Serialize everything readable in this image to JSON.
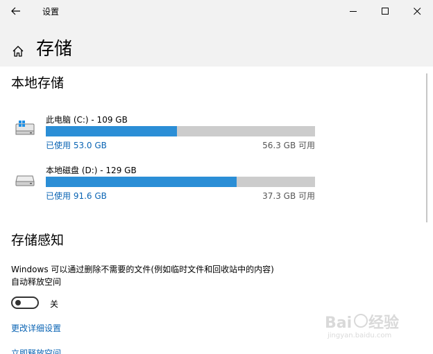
{
  "window": {
    "title": "设置"
  },
  "header": {
    "page_title": "存储"
  },
  "local_storage": {
    "section_title": "本地存储",
    "drives": [
      {
        "name": "此电脑 (C:) - 109 GB",
        "used": "已使用 53.0 GB",
        "free": "56.3 GB 可用",
        "used_fraction": 0.486,
        "icon": "windows-drive-icon"
      },
      {
        "name": "本地磁盘 (D:) - 129 GB",
        "used": "已使用 91.6 GB",
        "free": "37.3 GB 可用",
        "used_fraction": 0.71,
        "icon": "hard-drive-icon"
      }
    ]
  },
  "storage_sense": {
    "section_title": "存储感知",
    "description_line1": "Windows 可以通过删除不需要的文件(例如临时文件和回收站中的内容)",
    "description_line2": "自动释放空间",
    "toggle_state": "关",
    "toggle_on": false,
    "link_change_settings": "更改详细设置",
    "link_free_now": "立即释放空间"
  },
  "colors": {
    "bar_fill": "#2b8ed6",
    "bar_track": "#cccccc",
    "link": "#0a64b4",
    "header_bg": "#f2f2f2"
  }
}
